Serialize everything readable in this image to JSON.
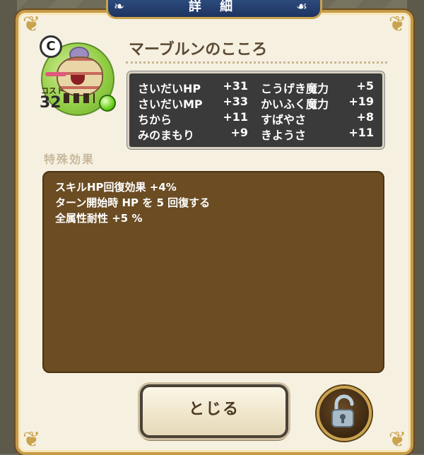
{
  "header": {
    "title": "詳 細"
  },
  "monster": {
    "rank": "C",
    "cost_label": "コスト",
    "cost": "32",
    "name": "マーブルンのこころ"
  },
  "stats": [
    {
      "name": "さいだいHP",
      "value": "+31"
    },
    {
      "name": "こうげき魔力",
      "value": "+5"
    },
    {
      "name": "さいだいMP",
      "value": "+33"
    },
    {
      "name": "かいふく魔力",
      "value": "+19"
    },
    {
      "name": "ちから",
      "value": "+11"
    },
    {
      "name": "すばやさ",
      "value": "+8"
    },
    {
      "name": "みのまもり",
      "value": "+9"
    },
    {
      "name": "きようさ",
      "value": "+11"
    }
  ],
  "special": {
    "label": "特殊効果",
    "effects": [
      "スキルHP回復効果 +4%",
      "ターン開始時 HP を 5 回復する",
      "全属性耐性 +5 %"
    ]
  },
  "buttons": {
    "close_label": "とじる",
    "lock_icon": "unlock-icon"
  },
  "colors": {
    "stats_bg": "#3a3a3a",
    "effects_bg": "#6b4c23",
    "header_bg": "#1d3461",
    "gold_frame": "#c49a4a",
    "orb_green": "#8fcb42"
  }
}
